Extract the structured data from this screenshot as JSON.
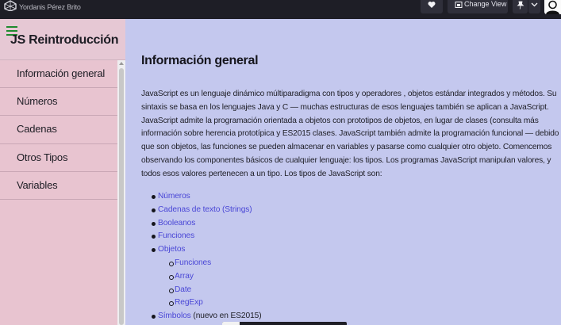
{
  "topbar": {
    "author": "Yordanis Pérez Brito",
    "change_view_label": "Change View"
  },
  "sidebar": {
    "title": "JS Reintroducción",
    "items": [
      {
        "label": "Información general"
      },
      {
        "label": "Números"
      },
      {
        "label": "Cadenas"
      },
      {
        "label": "Otros Tipos"
      },
      {
        "label": "Variables"
      }
    ]
  },
  "main": {
    "title": "Información general",
    "intro": "JavaScript es un lenguaje dinámico múltiparadigma con tipos y operadores , objetos estándar integrados y métodos. Su sintaxis se basa en los lenguajes Java y C — muchas estructuras de esos lenguajes también se aplican a JavaScript. JavaScript admite la programación orientada a objetos con prototipos de objetos, en lugar de clases (consulta más información sobre herencia prototípica y ES2015 clases. JavaScript también admite la programación funcional — debido a que son objetos, las funciones se pueden almacenar en variables y pasarse como cualquier otro objeto. Comencemos observando los componentes básicos de cualquier lenguaje: los tipos. Los programas JavaScript manipulan valores, y todos esos valores pertenecen a un tipo. Los tipos de JavaScript son:",
    "types": {
      "numeros": "Números",
      "cadenas": "Cadenas de texto (Strings)",
      "booleanos": "Booleanos",
      "funciones": "Funciones",
      "objetos": "Objetos",
      "objetos_sub": [
        "Funciones",
        "Array",
        "Date",
        "RegExp"
      ],
      "simbolos": "Símbolos",
      "simbolos_note": " (nuevo en ES2015)"
    }
  },
  "colors": {
    "accent": "#4a47d6",
    "hamburger": "#1e8a2e",
    "sidebar_bg": "#e8c4d0",
    "main_bg": "#c4c8ee"
  },
  "icons": [
    "logo-icon",
    "heart-icon",
    "change-view-icon",
    "pin-icon",
    "chevron-down-icon",
    "avatar-icon",
    "hamburger-menu-icon"
  ]
}
